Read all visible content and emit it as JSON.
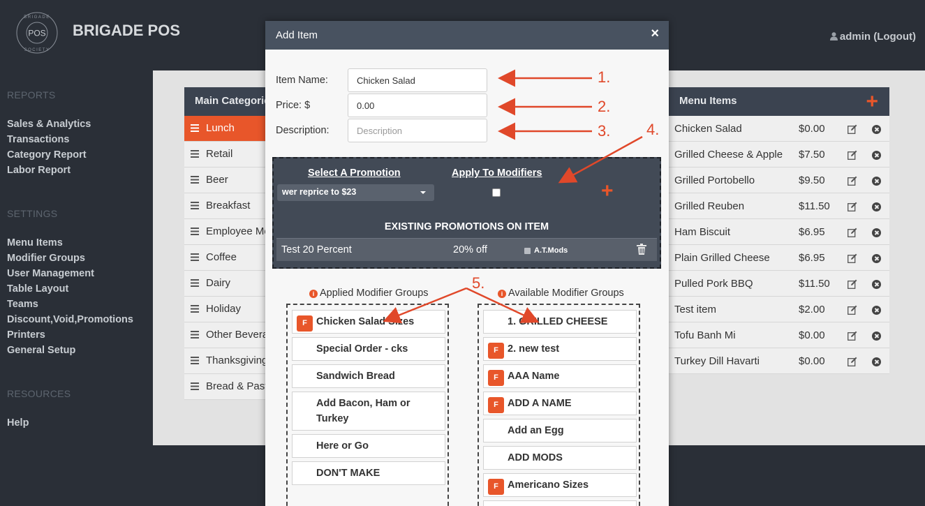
{
  "brand": {
    "logo_top": "BRIGADE",
    "logo_mid": "POS",
    "logo_bottom": "SOCIETY",
    "title": "BRIGADE POS"
  },
  "user": {
    "label": "admin (Logout)"
  },
  "sidebar": {
    "reports_heading": "REPORTS",
    "reports": [
      "Sales & Analytics",
      "Transactions",
      "Category Report",
      "Labor Report"
    ],
    "settings_heading": "SETTINGS",
    "settings": [
      "Menu Items",
      "Modifier Groups",
      "User Management",
      "Table Layout",
      "Teams",
      "Discount,Void,Promotions",
      "Printers",
      "General Setup"
    ],
    "resources_heading": "RESOURCES",
    "resources": [
      "Help"
    ]
  },
  "categories": {
    "heading": "Main Categories",
    "items": [
      "Lunch",
      "Retail",
      "Beer",
      "Breakfast",
      "Employee Meals",
      "Coffee",
      "Dairy",
      "Holiday",
      "Other Beverages",
      "Thanksgiving",
      "Bread & Pastry"
    ]
  },
  "menu_items": {
    "heading": "Menu Items",
    "add_icon": "+",
    "rows": [
      {
        "name": "Chicken Salad",
        "price": "$0.00"
      },
      {
        "name": "Grilled Cheese & Apple",
        "price": "$7.50"
      },
      {
        "name": "Grilled Portobello",
        "price": "$9.50"
      },
      {
        "name": "Grilled Reuben",
        "price": "$11.50"
      },
      {
        "name": "Ham Biscuit",
        "price": "$6.95"
      },
      {
        "name": "Plain Grilled Cheese",
        "price": "$6.95"
      },
      {
        "name": "Pulled Pork BBQ",
        "price": "$11.50"
      },
      {
        "name": "Test item",
        "price": "$2.00"
      },
      {
        "name": "Tofu Banh Mi",
        "price": "$0.00"
      },
      {
        "name": "Turkey Dill Havarti",
        "price": "$0.00"
      }
    ]
  },
  "modal": {
    "title": "Add Item",
    "close": "×",
    "item_name_label": "Item Name:",
    "item_name_value": "Chicken Salad",
    "price_label": "Price: $",
    "price_value": "0.00",
    "description_label": "Description:",
    "description_placeholder": "Description",
    "promo": {
      "select_label": "Select A Promotion",
      "apply_label": "Apply To Modifiers",
      "selected": "wer reprice to $23",
      "add_icon": "+",
      "existing_heading": "EXISTING PROMOTIONS ON ITEM",
      "existing": {
        "name": "Test 20 Percent",
        "discount": "20% off",
        "mods_label": "A.T.Mods"
      }
    },
    "applied_title": "Applied Modifier Groups",
    "available_title": "Available Modifier Groups",
    "applied": [
      "Chicken Salad Sizes",
      "Special Order - cks",
      "Sandwich Bread",
      "Add Bacon, Ham or Turkey",
      "Here or Go",
      "DON'T MAKE"
    ],
    "available": [
      "1. GRILLED CHEESE",
      "2. new test",
      "AAA Name",
      "ADD A NAME",
      "Add an Egg",
      "ADD MODS",
      "Americano Sizes"
    ],
    "badge_letter": "F"
  },
  "annotations": [
    "1.",
    "2.",
    "3.",
    "4.",
    "5."
  ],
  "colors": {
    "accent": "#e8562a",
    "sidebar_bg": "#2a2f37",
    "header_bg": "#3b4350",
    "annotation": "#e0482a"
  }
}
